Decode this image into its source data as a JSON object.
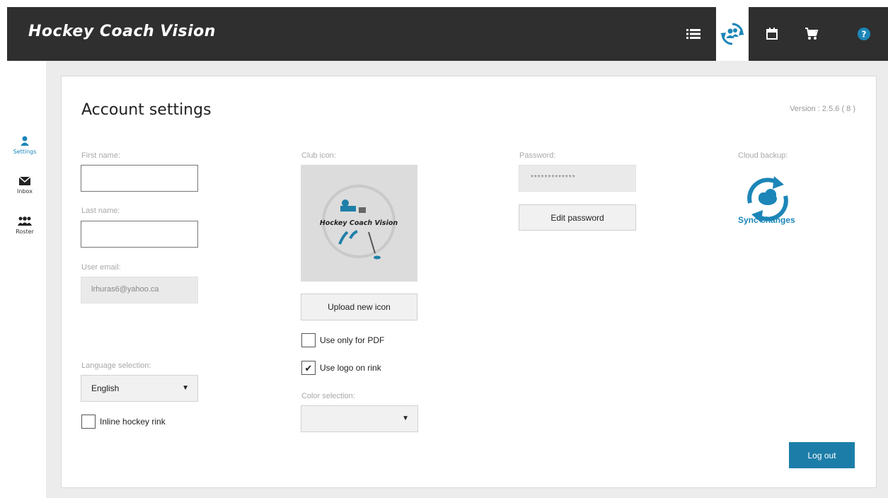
{
  "app": {
    "title": "Hockey Coach Vision"
  },
  "topnav": {
    "icons": [
      "list-icon",
      "account-sync-icon",
      "calendar-icon",
      "cart-icon",
      "help-icon"
    ],
    "active": "account-sync-icon"
  },
  "sidebar": {
    "items": [
      {
        "label": "Settings",
        "icon": "person-icon",
        "active": true
      },
      {
        "label": "Inbox",
        "icon": "mail-icon",
        "active": false
      },
      {
        "label": "Roster",
        "icon": "group-icon",
        "active": false
      }
    ]
  },
  "page": {
    "title": "Account settings",
    "version": "Version : 2.5.6 ( 8 )"
  },
  "form": {
    "first_name": {
      "label": "First name:",
      "value": ""
    },
    "last_name": {
      "label": "Last name:",
      "value": ""
    },
    "email": {
      "label": "User email:",
      "value": "lrhuras6@yahoo.ca"
    },
    "language": {
      "label": "Language selection:",
      "value": "English"
    },
    "inline_rink": {
      "label": "Inline hockey rink",
      "checked": false
    },
    "club_icon": {
      "label": "Club icon:",
      "logo_text": "Hockey Coach Vision"
    },
    "upload_button": "Upload new icon",
    "pdf_only": {
      "label": "Use only for PDF",
      "checked": false
    },
    "logo_on_rink": {
      "label": "Use logo on rink",
      "checked": true
    },
    "color": {
      "label": "Color selection:",
      "value": ""
    },
    "password": {
      "label": "Password:",
      "value": "*************"
    },
    "edit_password_button": "Edit password",
    "cloud": {
      "label": "Cloud backup:",
      "action": "Sync changes"
    },
    "logout_button": "Log out"
  },
  "colors": {
    "accent": "#1c86b8",
    "topbar": "#2f2f2f",
    "logout": "#1c7ea8"
  }
}
